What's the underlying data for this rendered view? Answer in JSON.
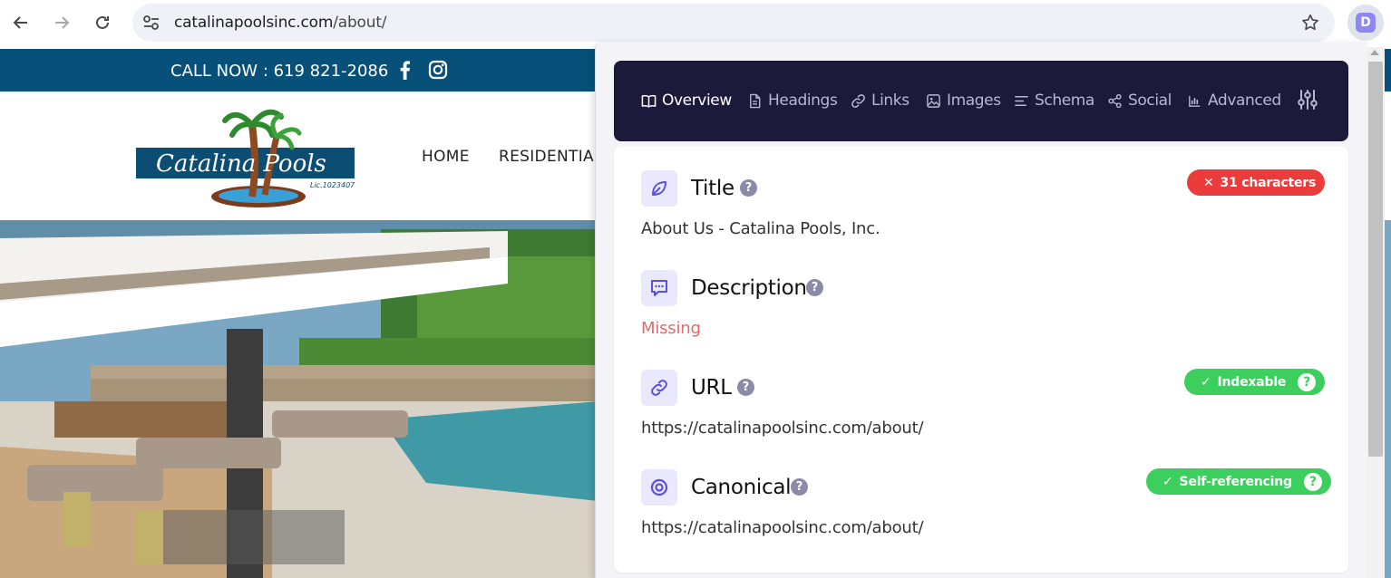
{
  "browser": {
    "url_domain": "catalinapoolsinc.com",
    "url_path": "/about/",
    "extension_letter": "D"
  },
  "site": {
    "call_now": "CALL NOW : 619 821-2086",
    "logo_text": "Catalina Pools",
    "logo_license": "Lic.1023407",
    "menu": [
      "HOME",
      "RESIDENTIAL"
    ]
  },
  "extension": {
    "tabs": [
      {
        "label": "Overview",
        "icon": "book-icon",
        "active": true
      },
      {
        "label": "Headings",
        "icon": "document-icon",
        "active": false
      },
      {
        "label": "Links",
        "icon": "link-icon",
        "active": false
      },
      {
        "label": "Images",
        "icon": "image-icon",
        "active": false
      },
      {
        "label": "Schema",
        "icon": "list-icon",
        "active": false
      },
      {
        "label": "Social",
        "icon": "share-icon",
        "active": false
      },
      {
        "label": "Advanced",
        "icon": "chart-icon",
        "active": false
      }
    ],
    "fields": {
      "title": {
        "label": "Title",
        "value": "About Us - Catalina Pools, Inc.",
        "badge": "31 characters",
        "badge_color": "#ec3b3b"
      },
      "description": {
        "label": "Description",
        "value": "Missing"
      },
      "url": {
        "label": "URL",
        "value": "https://catalinapoolsinc.com/about/",
        "badge": "Indexable",
        "badge_color": "#3ccf5d"
      },
      "canonical": {
        "label": "Canonical",
        "value": "https://catalinapoolsinc.com/about/",
        "badge": "Self-referencing",
        "badge_color": "#3ccf5d"
      }
    },
    "help_glyph": "?",
    "colors": {
      "accent": "#5b4fe0",
      "tabbar": "#1b1a3a",
      "topbar": "#07507a"
    }
  }
}
